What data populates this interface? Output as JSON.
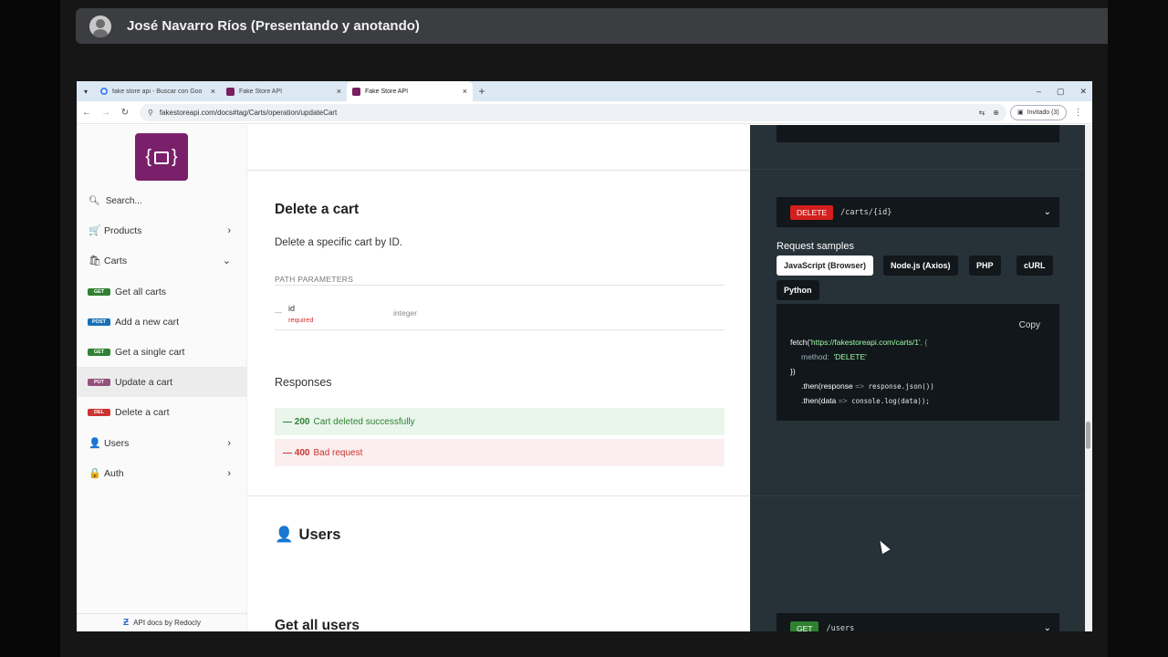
{
  "meet": {
    "presenter": "José Navarro Ríos (Presentando y anotando)"
  },
  "browser": {
    "tabs": [
      {
        "title": "fake store api - Buscar con Goo",
        "close": "×"
      },
      {
        "title": "Fake Store API",
        "close": "×"
      },
      {
        "title": "Fake Store API",
        "close": "×"
      }
    ],
    "new_tab": "+",
    "url": "fakestoreapi.com/docs#tag/Carts/operation/updateCart",
    "guest_label": "Invitado (3)",
    "win": {
      "min": "–",
      "max": "▢",
      "close": "✕"
    }
  },
  "sidebar": {
    "search_placeholder": "Search...",
    "products": "Products",
    "carts": "Carts",
    "cart_ops": [
      {
        "method": "GET",
        "label": "Get all carts"
      },
      {
        "method": "POST",
        "label": "Add a new cart"
      },
      {
        "method": "GET",
        "label": "Get a single cart"
      },
      {
        "method": "PUT",
        "label": "Update a cart"
      },
      {
        "method": "DEL",
        "label": "Delete a cart"
      }
    ],
    "users": "Users",
    "auth": "Auth",
    "footer": "API docs by Redocly"
  },
  "content": {
    "title": "Delete a cart",
    "description": "Delete a specific cart by ID.",
    "path_params_label": "PATH PARAMETERS",
    "param": {
      "name": "id",
      "required": "required",
      "type": "integer"
    },
    "responses_label": "Responses",
    "responses": [
      {
        "code": "200",
        "text": "Cart deleted successfully"
      },
      {
        "code": "400",
        "text": "Bad request"
      }
    ],
    "users_heading": "Users",
    "next_title": "Get all users"
  },
  "panel": {
    "endpoint": {
      "method": "DELETE",
      "path": "/carts/{id}"
    },
    "request_samples": "Request samples",
    "langs": [
      "JavaScript (Browser)",
      "Node.js (Axios)",
      "PHP",
      "cURL",
      "Python"
    ],
    "copy": "Copy",
    "code": {
      "l1_fn": "fetch(",
      "l1_str": "'https://fakestoreapi.com/carts/1'",
      "l1_end": ", {",
      "l2_key": "method",
      "l2_val": "'DELETE'",
      "l3": "})",
      "l4_a": ".then(response ",
      "l4_arrow": "=>",
      "l4_b": " response.json())",
      "l5_a": ".then(data ",
      "l5_arrow": "=>",
      "l5_b": " console.log(data));"
    },
    "next_endpoint": {
      "method": "GET",
      "path": "/users"
    }
  }
}
